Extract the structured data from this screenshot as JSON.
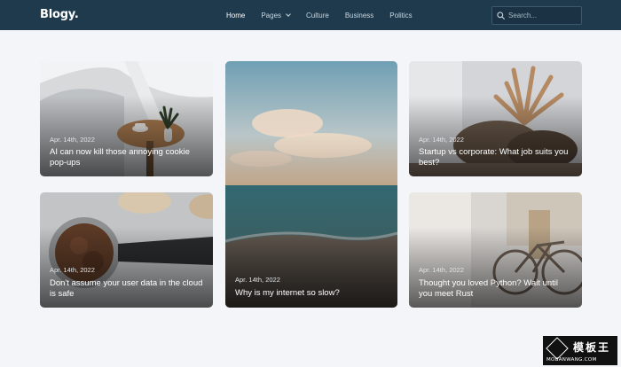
{
  "header": {
    "logo": "Blogy.",
    "nav": [
      {
        "label": "Home",
        "active": true
      },
      {
        "label": "Pages",
        "dropdown": true
      },
      {
        "label": "Culture"
      },
      {
        "label": "Business"
      },
      {
        "label": "Politics"
      }
    ],
    "search": {
      "placeholder": "Search...",
      "icon": "search-icon"
    }
  },
  "posts": [
    {
      "date": "Apr. 14th, 2022",
      "title": "AI can now kill those annoying cookie pop-ups"
    },
    {
      "date": "Apr. 14th, 2022",
      "title": "Why is my internet so slow?"
    },
    {
      "date": "Apr. 14th, 2022",
      "title": "Startup vs corporate: What job suits you best?"
    },
    {
      "date": "Apr. 14th, 2022",
      "title": "Don't assume your user data in the cloud is safe"
    },
    {
      "date": "Apr. 14th, 2022",
      "title": "Thought you loved Python? Wait until you meet Rust"
    }
  ],
  "watermark": {
    "text": "模板王",
    "url": "MOBANWANG.COM"
  },
  "colors": {
    "header_bg": "#1f3a4d",
    "page_bg": "#f3f5f8"
  }
}
